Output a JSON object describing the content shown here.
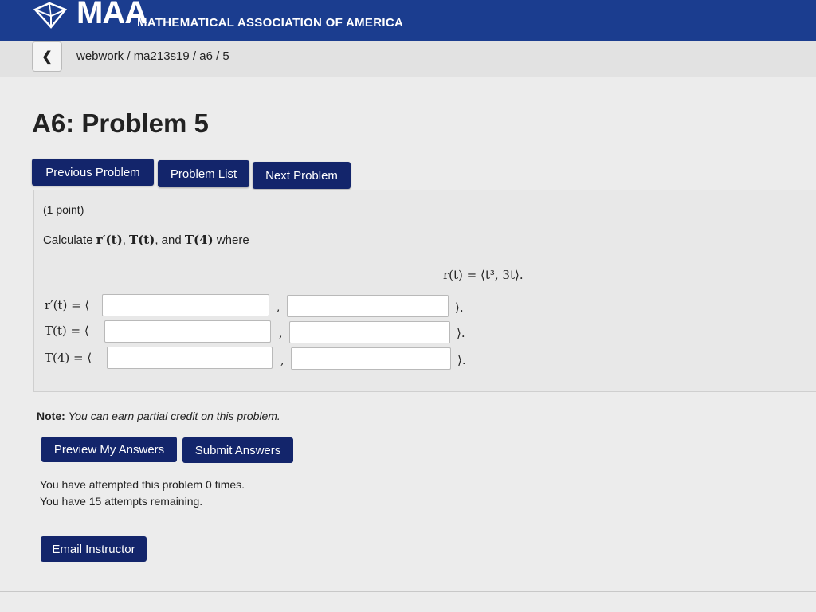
{
  "header": {
    "logo_text": "MAA",
    "org_name": "MATHEMATICAL ASSOCIATION OF AMERICA",
    "accent_color": "#1b3d8f"
  },
  "breadcrumb": {
    "back_icon": "chevron-left-icon",
    "text": "webwork / ma213s19 / a6 / 5"
  },
  "page": {
    "title": "A6: Problem 5"
  },
  "nav": {
    "previous_label": "Previous Problem",
    "list_label": "Problem List",
    "next_label": "Next Problem",
    "button_color": "#13256b"
  },
  "problem": {
    "points": "(1 point)",
    "question": {
      "prefix": "Calculate ",
      "r_prime": "r′(t)",
      "sep1": ", ",
      "T": "T(t)",
      "sep2": ", and ",
      "T4": "T(4)",
      "suffix": " where"
    },
    "equation": "r(t) = ⟨t³, 3t⟩.",
    "rows": [
      {
        "label": "r′(t) = ⟨",
        "value1": "",
        "value2": "",
        "comma": ",",
        "close": "⟩."
      },
      {
        "label": "T(t) = ⟨",
        "value1": "",
        "value2": "",
        "comma": ",",
        "close": "⟩."
      },
      {
        "label": "T(4) = ⟨",
        "value1": "",
        "value2": "",
        "comma": ",",
        "close": "⟩."
      }
    ]
  },
  "note": {
    "label": "Note:",
    "text": "You can earn partial credit on this problem."
  },
  "actions": {
    "preview_label": "Preview My Answers",
    "submit_label": "Submit Answers"
  },
  "attempts": {
    "line1": "You have attempted this problem 0 times.",
    "line2": "You have 15 attempts remaining."
  },
  "footer": {
    "email_label": "Email Instructor"
  }
}
